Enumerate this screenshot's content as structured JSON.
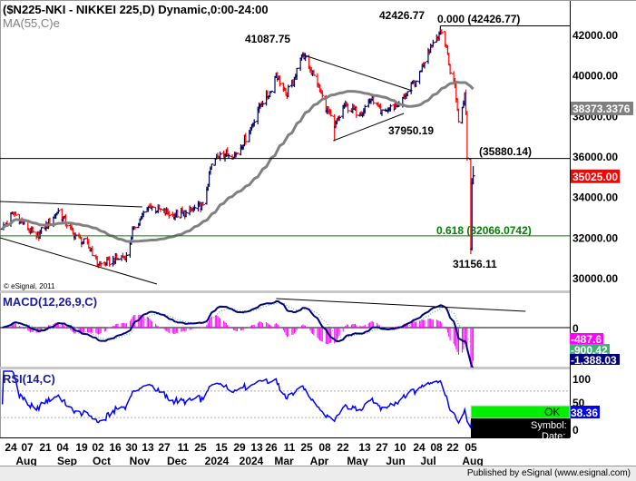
{
  "header": {
    "title": "($N225-NKI - NIKKEI 225,D) Dynamic,0:00-24:00",
    "ma_label": "MA(55,C)e",
    "watermark": "© eSignal, 2011"
  },
  "chart_data": {
    "type": "ohlc",
    "symbol": "$N225-NKI",
    "interval": "D",
    "colors": {
      "up": "#000066",
      "down": "#ff0000",
      "ma": "#808080",
      "fib": "#008000"
    },
    "price_axis": {
      "ticks": [
        "42000.00",
        "40000.00",
        "38000.00",
        "36000.00",
        "34000.00",
        "32000.00",
        "30000.00"
      ],
      "range": [
        29500,
        43000
      ]
    },
    "anchors": [
      [
        "2023-07-17",
        32400
      ],
      [
        "2023-07-26",
        33200
      ],
      [
        "2023-08-14",
        32000
      ],
      [
        "2023-09-01",
        33300
      ],
      [
        "2023-09-13",
        32200
      ],
      [
        "2023-09-28",
        31400
      ],
      [
        "2023-10-04",
        30600
      ],
      [
        "2023-10-27",
        31100
      ],
      [
        "2023-11-02",
        32500
      ],
      [
        "2023-11-15",
        33500
      ],
      [
        "2023-12-04",
        33100
      ],
      [
        "2023-12-15",
        33200
      ],
      [
        "2023-12-29",
        33600
      ],
      [
        "2024-01-05",
        35600
      ],
      [
        "2024-01-12",
        36100
      ],
      [
        "2024-01-25",
        36100
      ],
      [
        "2024-02-05",
        37200
      ],
      [
        "2024-02-13",
        38500
      ],
      [
        "2024-02-23",
        39200
      ],
      [
        "2024-02-27",
        40100
      ],
      [
        "2024-03-06",
        39000
      ],
      [
        "2024-03-13",
        39800
      ],
      [
        "2024-03-18",
        40800
      ],
      [
        "2024-03-22",
        40888,
        null,
        41087.75
      ],
      [
        "2024-04-01",
        39500
      ],
      [
        "2024-04-15",
        37400,
        36733
      ],
      [
        "2024-04-23",
        38500
      ],
      [
        "2024-05-06",
        38100
      ],
      [
        "2024-05-16",
        38900
      ],
      [
        "2024-05-23",
        38100
      ],
      [
        "2024-06-07",
        38600
      ],
      [
        "2024-06-21",
        39700
      ],
      [
        "2024-07-01",
        41200
      ],
      [
        "2024-07-11",
        42224,
        null,
        42426.77
      ],
      [
        "2024-07-16",
        41400
      ],
      [
        "2024-07-19",
        40100
      ],
      [
        "2024-07-23",
        39500
      ],
      [
        "2024-07-26",
        37700
      ],
      [
        "2024-07-29",
        38400
      ],
      [
        "2024-07-31",
        39100
      ],
      [
        "2024-08-01",
        38100
      ],
      [
        "2024-08-02",
        35900
      ],
      [
        "2024-08-05",
        31458,
        31156.11
      ],
      [
        "2024-08-06",
        34675,
        null,
        34911
      ],
      [
        "2024-08-07",
        35025,
        null,
        35500
      ]
    ],
    "moving_average": {
      "label": "MA(55,C)e",
      "period": 55,
      "last": "38373.3376"
    },
    "last_price": "35025.00",
    "annotations": [
      {
        "text": "41087.75"
      },
      {
        "text": "42426.77"
      },
      {
        "text": "37950.19"
      },
      {
        "text": "31156.11"
      }
    ],
    "levels": [
      {
        "label": "0.000 (42426.77)",
        "value": 42426.77,
        "from": "2024-07-11"
      },
      {
        "label": "(35880.14)",
        "value": 35880.14
      },
      {
        "label": "0.618 (32066.0742)",
        "value": 32066.0742
      }
    ],
    "trendlines": [
      [
        [
          "2023-07-15",
          33760
        ],
        [
          "2023-11-09",
          33490
        ]
      ],
      [
        [
          "2023-07-15",
          31970
        ],
        [
          "2023-11-21",
          29685
        ]
      ],
      [
        [
          "2024-03-19",
          41015
        ],
        [
          "2024-06-18",
          39224
        ]
      ],
      [
        [
          "2024-04-14",
          36760
        ],
        [
          "2024-06-11",
          38104
        ]
      ]
    ],
    "x_axis": {
      "day_ticks": [
        "24",
        "07",
        "21",
        "04",
        "19",
        "02",
        "16",
        "30",
        "13",
        "27",
        "11",
        "25",
        "15",
        "29",
        "13",
        "26",
        "11",
        "25",
        "08",
        "22",
        "13",
        "27",
        "10",
        "24",
        "08",
        "22",
        "05"
      ],
      "month_labels": [
        "Aug",
        "Sep",
        "Oct",
        "Nov",
        "Dec",
        "2024",
        "2024",
        "Mar",
        "Apr",
        "May",
        "Jun",
        "Jul",
        "Aug"
      ]
    },
    "macd": {
      "label": "MACD(12,26,9,C)",
      "zero_label": "0",
      "histogram_last": "-487.6",
      "signal_last": "-900.42",
      "macd_last": "-1,388.03",
      "trendline": [
        [
          "2024-02-27",
          1056
        ],
        [
          "2024-09-19",
          594
        ]
      ],
      "colors": {
        "macd": "#000080",
        "signal": "#3cb371",
        "histogram": "#ff00ff"
      }
    },
    "rsi": {
      "label": "RSI(14,C)",
      "ticks": [
        "100",
        "50",
        "0"
      ],
      "levels": [
        70,
        30
      ],
      "last": "38.36",
      "color": "#0000ff"
    }
  },
  "popup": {
    "ok": "OK",
    "symbol_label": "Symbol:",
    "date_label": "Date:"
  },
  "footer": {
    "published": "Published by eSignal (www.esignal.com)"
  }
}
